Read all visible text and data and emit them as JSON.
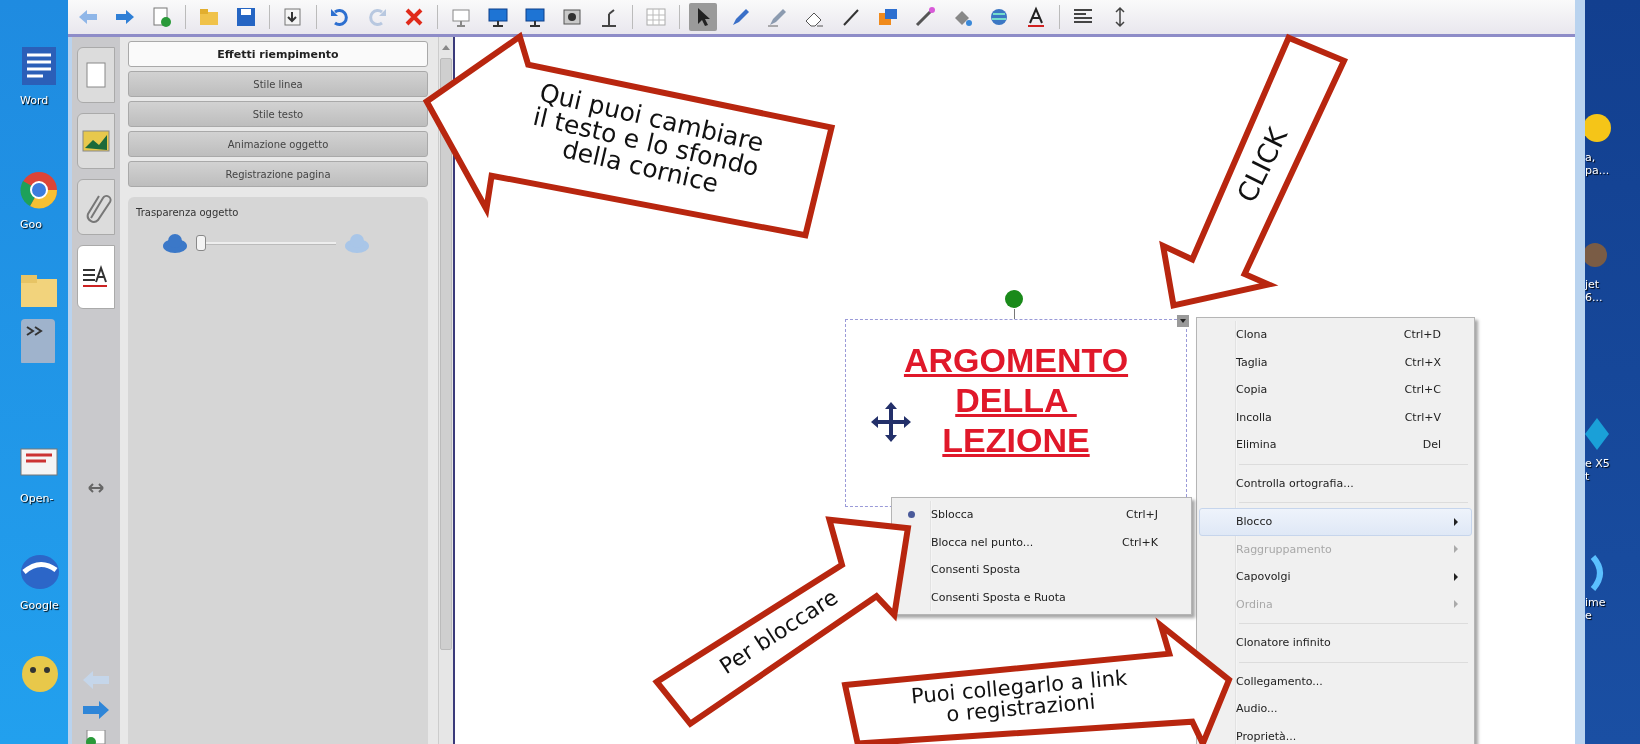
{
  "desktop_left": [
    {
      "kind": "document",
      "label": "Word"
    },
    {
      "kind": "browser",
      "label": "Goo"
    },
    {
      "kind": "folder"
    },
    {
      "kind": "gadget"
    },
    {
      "kind": "presentation",
      "label": "Open-"
    },
    {
      "kind": "globe",
      "label": "Google"
    },
    {
      "kind": "smiley"
    }
  ],
  "desktop_right": [
    {
      "label": "a,\npa..."
    },
    {
      "label": "jet\n6..."
    },
    {
      "label": "e X5\nt"
    },
    {
      "label": "ime\ne"
    }
  ],
  "toolbar": {
    "tools": [
      {
        "selected": true
      },
      {
        "selected": false
      },
      {
        "selected": false
      },
      {
        "selected": false
      },
      {
        "selected": false
      },
      {
        "selected": false
      },
      {
        "selected": false
      },
      {
        "selected": false
      },
      {
        "selected": false
      },
      {
        "selected": false
      }
    ]
  },
  "side_tabs": [
    {
      "selected": false
    },
    {
      "selected": false
    },
    {
      "selected": false
    },
    {
      "selected": true
    }
  ],
  "panel": {
    "sections": [
      {
        "label": "Effetti riempimento",
        "expanded": true
      },
      {
        "label": "Stile linea",
        "expanded": false
      },
      {
        "label": "Stile testo",
        "expanded": false
      },
      {
        "label": "Animazione oggetto",
        "expanded": false
      },
      {
        "label": "Registrazione pagina",
        "expanded": false
      }
    ],
    "transparency": {
      "label": "Trasparenza oggetto",
      "level": 0.0
    }
  },
  "canvas": {
    "text_box": {
      "lines": [
        "ARGOMENTO",
        "DELLA ",
        "LEZIONE"
      ]
    },
    "context_menu": {
      "items": [
        {
          "kind": "item",
          "label": "Clona",
          "shortcut": "Ctrl+D",
          "disabled": false,
          "highlighted": false,
          "submenu": false
        },
        {
          "kind": "item",
          "label": "Taglia",
          "shortcut": "Ctrl+X",
          "disabled": false,
          "highlighted": false,
          "submenu": false
        },
        {
          "kind": "item",
          "label": "Copia",
          "shortcut": "Ctrl+C",
          "disabled": false,
          "highlighted": false,
          "submenu": false
        },
        {
          "kind": "item",
          "label": "Incolla",
          "shortcut": "Ctrl+V",
          "disabled": false,
          "highlighted": false,
          "submenu": false
        },
        {
          "kind": "item",
          "label": "Elimina",
          "shortcut": "Del",
          "disabled": false,
          "highlighted": false,
          "submenu": false
        },
        {
          "kind": "separator"
        },
        {
          "kind": "item",
          "label": "Controlla ortografia...",
          "disabled": false,
          "highlighted": false,
          "submenu": false
        },
        {
          "kind": "separator"
        },
        {
          "kind": "item",
          "label": "Blocco",
          "disabled": false,
          "highlighted": true,
          "submenu": true
        },
        {
          "kind": "item",
          "label": "Raggruppamento",
          "disabled": true,
          "highlighted": false,
          "submenu": true
        },
        {
          "kind": "item",
          "label": "Capovolgi",
          "disabled": false,
          "highlighted": false,
          "submenu": true
        },
        {
          "kind": "item",
          "label": "Ordina",
          "disabled": true,
          "highlighted": false,
          "submenu": true
        },
        {
          "kind": "separator"
        },
        {
          "kind": "item",
          "label": "Clonatore infinito",
          "disabled": false,
          "highlighted": false,
          "submenu": false
        },
        {
          "kind": "separator"
        },
        {
          "kind": "item",
          "label": "Collegamento...",
          "disabled": false,
          "highlighted": false,
          "submenu": false
        },
        {
          "kind": "item",
          "label": "Audio...",
          "disabled": false,
          "highlighted": false,
          "submenu": false
        },
        {
          "kind": "item",
          "label": "Proprietà...",
          "disabled": false,
          "highlighted": false,
          "submenu": false
        }
      ]
    },
    "submenu": {
      "items": [
        {
          "label": "Sblocca",
          "shortcut": "Ctrl+J",
          "checked": true
        },
        {
          "label": "Blocca nel punto...",
          "shortcut": "Ctrl+K",
          "checked": false
        },
        {
          "label": "Consenti Sposta",
          "checked": false
        },
        {
          "label": "Consenti Sposta e Ruota",
          "checked": false
        }
      ]
    }
  },
  "callouts": [
    {
      "kind": "left",
      "lines": [
        "Qui puoi cambiare",
        "il testo e lo sfondo",
        "della cornice"
      ]
    },
    {
      "kind": "down-left",
      "lines": [
        "CLICK"
      ]
    },
    {
      "kind": "up-right",
      "lines": [
        "Per bloccare"
      ]
    },
    {
      "kind": "right",
      "lines": [
        "Puoi collegarlo a link",
        "o registrazioni"
      ]
    }
  ]
}
